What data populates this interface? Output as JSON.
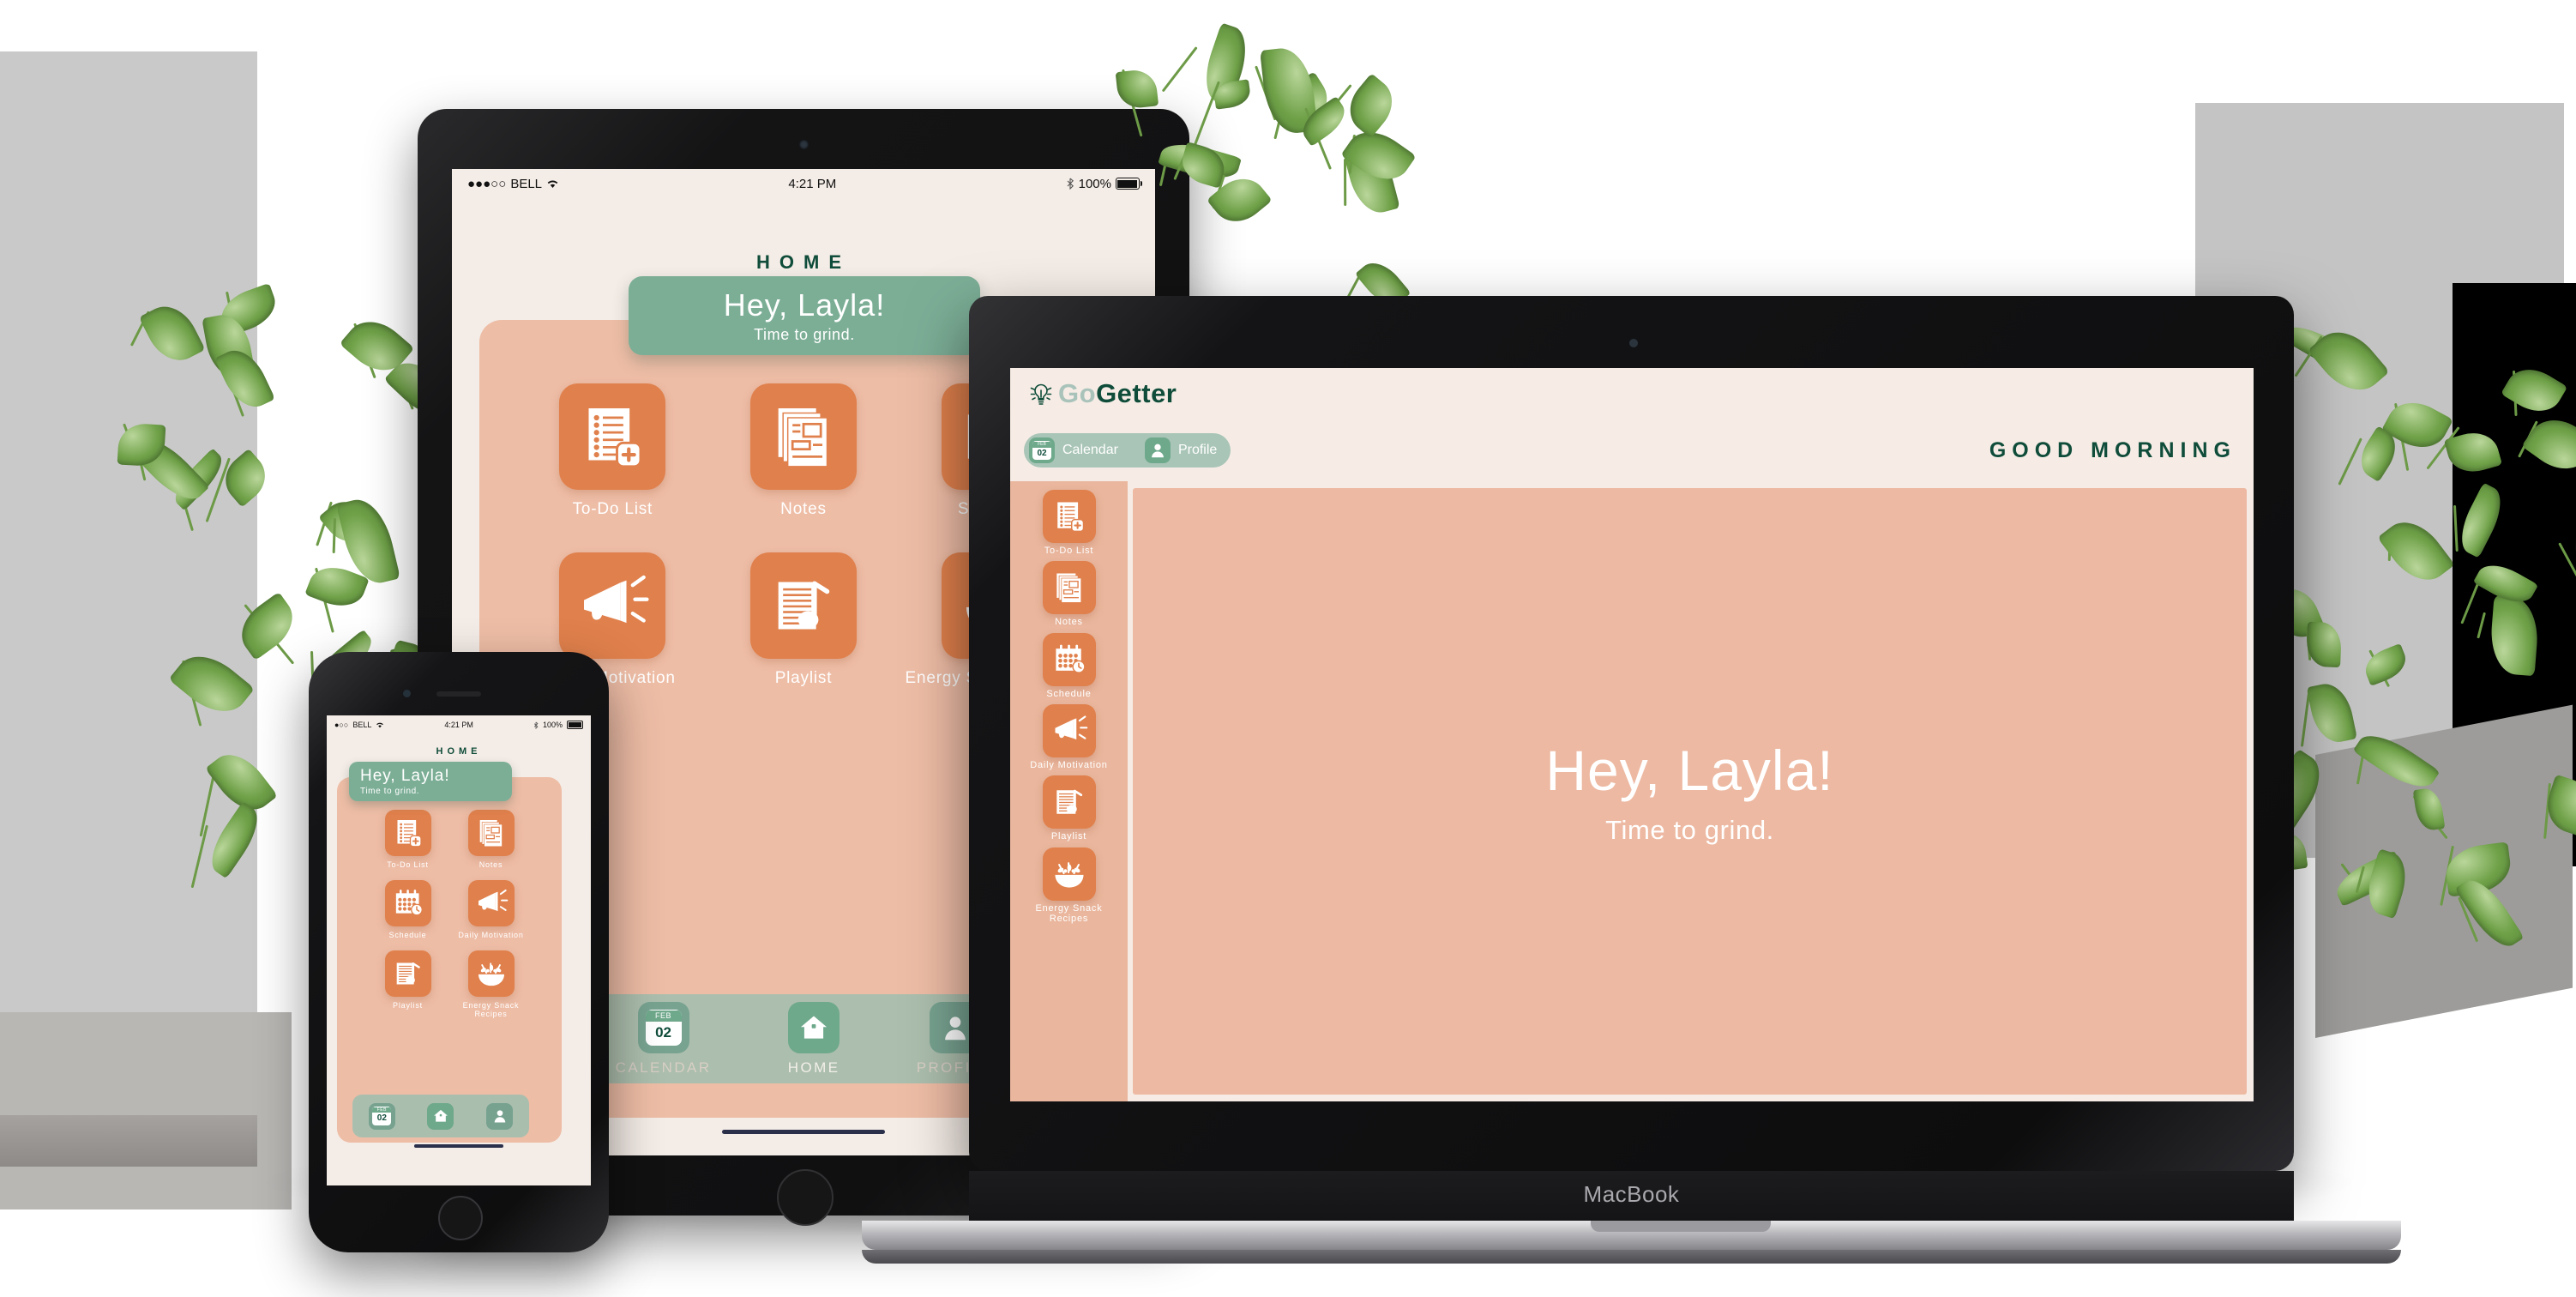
{
  "scene": {
    "device_label_macbook": "MacBook"
  },
  "brand": {
    "name_part1": "Go",
    "name_part2": "Getter",
    "logo_icon": "lightbulb-icon",
    "color_dark_green": "#0f4c3a",
    "color_light_green": "#a9c3bb",
    "color_mint": "#7cae96",
    "color_orange": "#e0804c",
    "color_peach": "#eebda6",
    "color_cream": "#f6ece5"
  },
  "macbook": {
    "topnav": {
      "calendar_label": "Calendar",
      "calendar_icon": "calendar-icon",
      "calendar_month": "FEB",
      "calendar_day": "02",
      "profile_label": "Profile",
      "profile_icon": "user-icon"
    },
    "greeting_banner": "GOOD MORNING",
    "sidebar": [
      {
        "label": "To-Do List",
        "icon": "checklist-add-icon"
      },
      {
        "label": "Notes",
        "icon": "documents-icon"
      },
      {
        "label": "Schedule",
        "icon": "calendar-clock-icon"
      },
      {
        "label": "Daily Motivation",
        "icon": "megaphone-icon"
      },
      {
        "label": "Playlist",
        "icon": "music-sheet-icon"
      },
      {
        "label": "Energy Snack Recipes",
        "icon": "salad-bowl-icon"
      }
    ],
    "canvas": {
      "title": "Hey, Layla!",
      "subtitle": "Time to grind."
    }
  },
  "ipad": {
    "statusbar": {
      "signal": "●●●○○",
      "carrier": "BELL",
      "wifi_icon": "wifi-icon",
      "time": "4:21 PM",
      "bluetooth_icon": "bluetooth-icon",
      "battery_percent": "100%",
      "battery_icon": "battery-full-icon"
    },
    "page_title": "HOME",
    "greeting": {
      "title": "Hey, Layla!",
      "subtitle": "Time to grind."
    },
    "apps": [
      {
        "label": "To-Do List",
        "icon": "checklist-add-icon"
      },
      {
        "label": "Notes",
        "icon": "documents-icon"
      },
      {
        "label": "Schedule",
        "icon": "calendar-clock-icon"
      },
      {
        "label": "Daily Motivation",
        "icon": "megaphone-icon"
      },
      {
        "label": "Playlist",
        "icon": "music-sheet-icon"
      },
      {
        "label": "Energy Snack Recipes",
        "icon": "salad-bowl-icon"
      }
    ],
    "tabbar": [
      {
        "label": "CALENDAR",
        "icon": "calendar-icon",
        "active": false
      },
      {
        "label": "HOME",
        "icon": "home-icon",
        "active": true
      },
      {
        "label": "PROFILE",
        "icon": "user-icon",
        "active": false
      }
    ],
    "calendar_month": "FEB",
    "calendar_day": "02"
  },
  "iphone": {
    "statusbar": {
      "signal": "●○○",
      "carrier": "BELL",
      "wifi_icon": "wifi-icon",
      "time": "4:21 PM",
      "bluetooth_icon": "bluetooth-icon",
      "battery_percent": "100%",
      "battery_icon": "battery-full-icon"
    },
    "page_title": "HOME",
    "greeting": {
      "title": "Hey, Layla!",
      "subtitle": "Time to grind."
    },
    "apps": [
      {
        "label": "To-Do List",
        "icon": "checklist-add-icon"
      },
      {
        "label": "Notes",
        "icon": "documents-icon"
      },
      {
        "label": "Schedule",
        "icon": "calendar-clock-icon"
      },
      {
        "label": "Daily Motivation",
        "icon": "megaphone-icon"
      },
      {
        "label": "Playlist",
        "icon": "music-sheet-icon"
      },
      {
        "label": "Energy Snack Recipes",
        "icon": "salad-bowl-icon"
      }
    ],
    "tabbar": [
      {
        "icon": "calendar-icon",
        "active": false
      },
      {
        "icon": "home-icon",
        "active": true
      },
      {
        "icon": "user-icon",
        "active": false
      }
    ],
    "calendar_month": "FEB",
    "calendar_day": "02"
  }
}
